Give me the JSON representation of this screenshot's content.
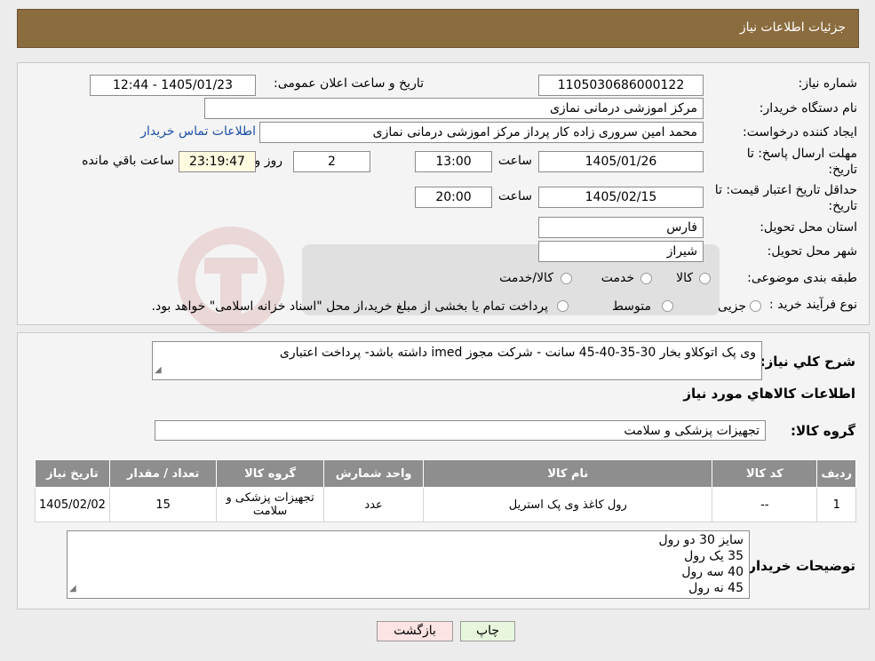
{
  "header": {
    "title": "جزئیات اطلاعات نیاز"
  },
  "info": {
    "need_number_label": "شماره نیاز:",
    "need_number": "1105030686000122",
    "announce_label": "تاریخ و ساعت اعلان عمومی:",
    "announce_value": "1405/01/23 - 12:44",
    "buyer_org_label": "نام دستگاه خریدار:",
    "buyer_org": "مرکز اموزشی درمانی نمازی",
    "creator_label": "ایجاد کننده درخواست:",
    "creator": "محمد امین سروری زاده کار پرداز مرکز اموزشی درمانی نمازی",
    "contact_link": "اطلاعات تماس خریدار",
    "reply_deadline_label_1": "مهلت ارسال پاسخ: تا",
    "reply_deadline_label_2": "تاریخ:",
    "reply_date": "1405/01/26",
    "time_label": "ساعت",
    "reply_time": "13:00",
    "days_value": "2",
    "days_label": "روز و",
    "remaining_time": "23:19:47",
    "remaining_label": "ساعت باقي مانده",
    "validity_label_1": "حداقل تاریخ اعتبار قیمت: تا",
    "validity_label_2": "تاریخ:",
    "validity_date": "1405/02/15",
    "validity_time": "20:00",
    "province_label": "استان محل تحویل:",
    "province": "فارس",
    "city_label": "شهر محل تحویل:",
    "city": "شیراز",
    "category_label": "طبقه بندی موضوعی:",
    "category_options": [
      "کالا",
      "خدمت",
      "کالا/خدمت"
    ],
    "process_label": "نوع فرآیند خرید :",
    "process_options": [
      "جزیی",
      "متوسط"
    ],
    "process_note": "پرداخت تمام یا بخشی از مبلغ خرید،از محل \"اسناد خزانه اسلامی\" خواهد بود."
  },
  "details": {
    "description_label": "شرح کلي نياز:",
    "description": "وی پک اتوکلاو بخار 30-35-40-45 سانت - شرکت مجوز imed داشته باشد- پرداخت اعتباری",
    "goods_info_title": "اطلاعات کالاهاي مورد نياز",
    "goods_group_label": "گروه کالا:",
    "goods_group": "تجهیزات پزشکی و سلامت",
    "table": {
      "headers": [
        "ردیف",
        "کد کالا",
        "نام کالا",
        "واحد شمارش",
        "گروه کالا",
        "تعداد / مقدار",
        "تاریخ نیاز"
      ],
      "rows": [
        [
          "1",
          "--",
          "رول کاغذ وی پک استریل",
          "عدد",
          "تجهیزات پزشکی و سلامت",
          "15",
          "1405/02/02"
        ]
      ]
    },
    "buyer_notes_label": "توضیحات خریدار:",
    "buyer_notes": [
      "سایز 30 دو رول",
      "35 یک رول",
      "40 سه رول",
      "45 نه رول"
    ]
  },
  "buttons": {
    "print": "چاپ",
    "back": "بازگشت"
  },
  "colors": {
    "header_bg": "#8b6c3f",
    "back_button_bg": "#fde3e3",
    "print_button_bg": "#e6f7dd",
    "link": "#1a4fa8"
  }
}
